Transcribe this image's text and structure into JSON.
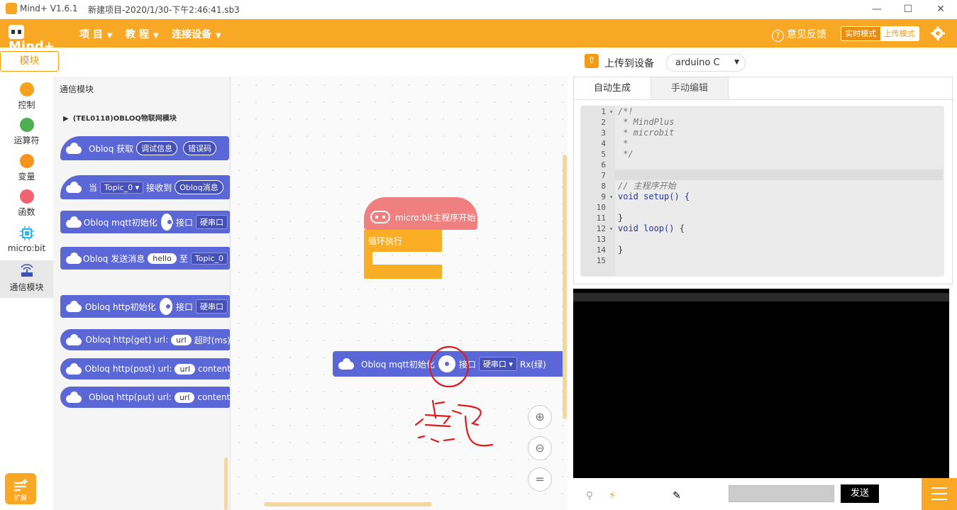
{
  "titlebar": {
    "app": "Mind+ V1.6.1",
    "file": "新建项目-2020/1/30-下午2:46:41.sb3",
    "minimize": "—",
    "maximize": "☐",
    "close": "✕"
  },
  "menubar": {
    "brand": "Mind+",
    "items": [
      "项 目",
      "教 程",
      "连接设备"
    ],
    "feedback": "意见反馈",
    "mode_realtime": "实时模式",
    "mode_upload": "上传模式"
  },
  "categories": {
    "tab": "模块",
    "items": [
      {
        "label": "控制",
        "color": "#f7a21b"
      },
      {
        "label": "运算符",
        "color": "#4caf50"
      },
      {
        "label": "变量",
        "color": "#f7941d"
      },
      {
        "label": "函数",
        "color": "#f06370"
      },
      {
        "label": "micro:bit",
        "color": "#29b6f6"
      },
      {
        "label": "通信模块",
        "color": "#3f51b5"
      }
    ],
    "extension": "扩展"
  },
  "palette": {
    "title": "通信模块",
    "subtitle": "(TEL0118)OBLOQ物联网模块",
    "blocks": {
      "b1": {
        "text": "Obloq 获取",
        "p1": "调试信息",
        "p2": "错误码"
      },
      "b2": {
        "text": "当",
        "dd": "Topic_0 ▾",
        "mid": "接收到",
        "p1": "Obloq消息"
      },
      "b3": {
        "text": "Obloq mqtt初始化",
        "mid": "接口",
        "dd": "硬串口"
      },
      "b4": {
        "text": "Obloq 发送消息",
        "p1": "hello",
        "mid": "至",
        "dd": "Topic_0"
      },
      "b5": {
        "text": "Obloq http初始化",
        "mid": "接口",
        "dd": "硬串口"
      },
      "b6": {
        "text": "Obloq http(get) url:",
        "p1": "url",
        "mid": "超时(ms)"
      },
      "b7": {
        "text": "Obloq http(post) url:",
        "p1": "url",
        "mid": "content"
      },
      "b8": {
        "text": "Obloq http(put) url:",
        "p1": "url",
        "mid": "content"
      }
    }
  },
  "workspace": {
    "hat_label": "micro:bit主程序开始",
    "loop_label": "循环执行",
    "mqtt_block": {
      "text": "Obloq mqtt初始化",
      "mid": "接口",
      "dd": "硬串口 ▾",
      "tail": "Rx(绿)"
    },
    "zoom_in": "⊕",
    "zoom_out": "⊖",
    "zoom_reset": "=",
    "annotation_color": "#e01b1b"
  },
  "upload": {
    "label": "上传到设备",
    "board": "arduino C"
  },
  "code_panel": {
    "tab_auto": "自动生成",
    "tab_manual": "手动编辑",
    "lines": [
      {
        "n": "1",
        "fold": "▾",
        "text": "/*!",
        "cls": "cm"
      },
      {
        "n": "2",
        "fold": "",
        "text": " * MindPlus",
        "cls": "cm"
      },
      {
        "n": "3",
        "fold": "",
        "text": " * microbit",
        "cls": "cm"
      },
      {
        "n": "4",
        "fold": "",
        "text": " *",
        "cls": "cm"
      },
      {
        "n": "5",
        "fold": "",
        "text": " */",
        "cls": "cm"
      },
      {
        "n": "6",
        "fold": "",
        "text": "",
        "cls": ""
      },
      {
        "n": "7",
        "fold": "",
        "text": "",
        "cls": ""
      },
      {
        "n": "8",
        "fold": "",
        "text": "// 主程序开始",
        "cls": "cm"
      },
      {
        "n": "9",
        "fold": "▾",
        "text": "void setup() {",
        "cls": "kw"
      },
      {
        "n": "10",
        "fold": "",
        "text": "",
        "cls": ""
      },
      {
        "n": "11",
        "fold": "",
        "text": "}",
        "cls": ""
      },
      {
        "n": "12",
        "fold": "▾",
        "text": "void loop() {",
        "cls": "kw"
      },
      {
        "n": "13",
        "fold": "",
        "text": "",
        "cls": ""
      },
      {
        "n": "14",
        "fold": "",
        "text": "}",
        "cls": ""
      },
      {
        "n": "15",
        "fold": "",
        "text": "",
        "cls": ""
      }
    ]
  },
  "serial": {
    "send_label": "发送"
  }
}
